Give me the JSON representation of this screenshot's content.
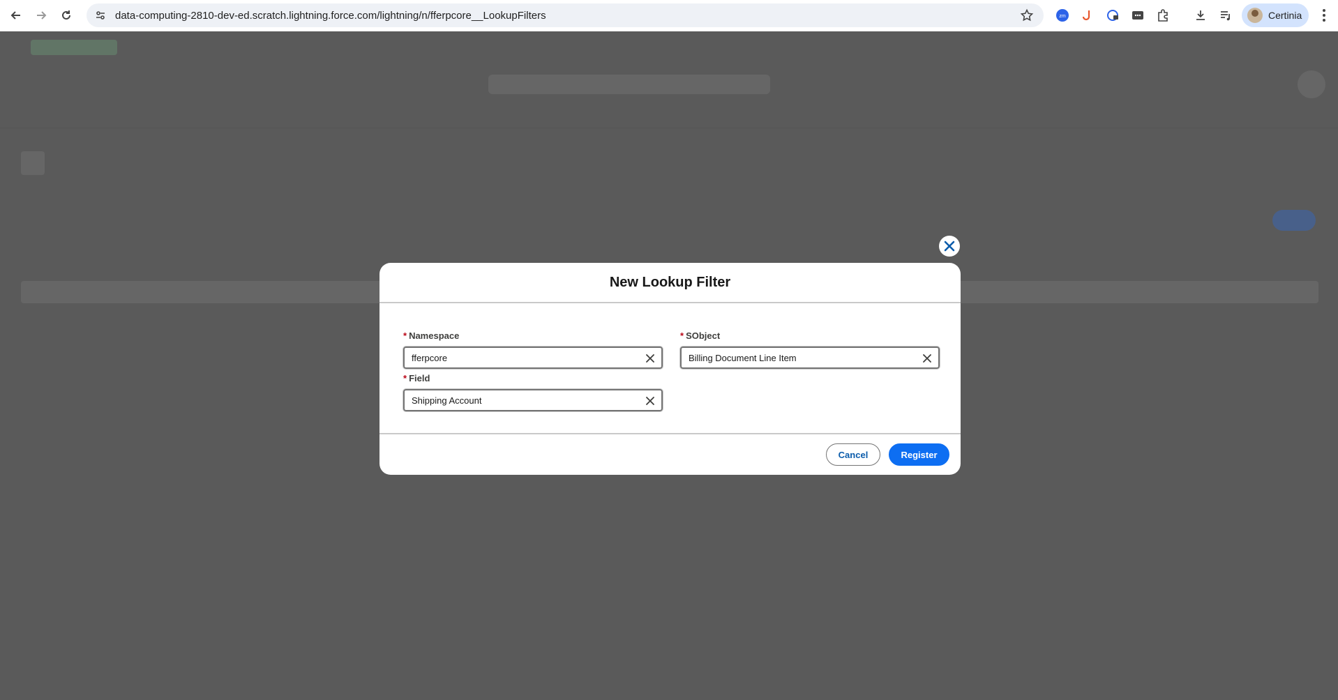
{
  "browser": {
    "url": "data-computing-2810-dev-ed.scratch.lightning.force.com/lightning/n/fferpcore__LookupFilters",
    "profile_name": "Certinia"
  },
  "modal": {
    "title": "New Lookup Filter",
    "fields": {
      "namespace": {
        "label": "Namespace",
        "required_mark": "*",
        "value": "fferpcore"
      },
      "sobject": {
        "label": "SObject",
        "required_mark": "*",
        "value": "Billing Document Line Item"
      },
      "field": {
        "label": "Field",
        "required_mark": "*",
        "value": "Shipping Account"
      }
    },
    "buttons": {
      "cancel": "Cancel",
      "register": "Register"
    }
  },
  "colors": {
    "brand_button": "#0d6ef2",
    "required": "#ba0517",
    "overlay": "#4e4e4e"
  }
}
